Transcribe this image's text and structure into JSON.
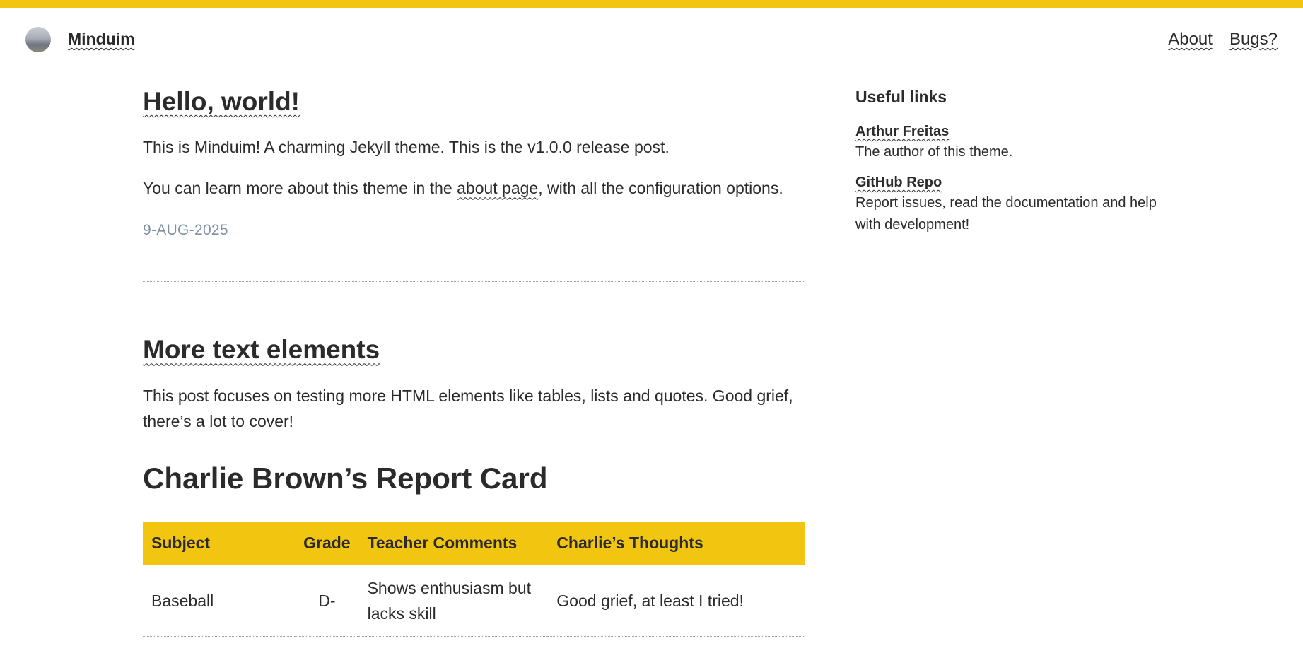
{
  "header": {
    "site_title": "Minduim",
    "nav": [
      {
        "label": "About"
      },
      {
        "label": "Bugs?"
      }
    ]
  },
  "posts": [
    {
      "title": "Hello, world!",
      "paragraphs": [
        "This is Minduim! A charming Jekyll theme. This is the v1.0.0 release post."
      ],
      "para2_before": "You can learn more about this theme in the ",
      "para2_link": "about page",
      "para2_after": ", with all the configuration options.",
      "date": "9-AUG-2025"
    },
    {
      "title": "More text elements",
      "paragraphs": [
        "This post focuses on testing more HTML elements like tables, lists and quotes. Good grief, there’s a lot to cover!"
      ],
      "report_heading": "Charlie Brown’s Report Card",
      "table": {
        "headers": [
          "Subject",
          "Grade",
          "Teacher Comments",
          "Charlie’s Thoughts"
        ],
        "rows": [
          [
            "Baseball",
            "D-",
            "Shows enthusiasm but lacks skill",
            "Good grief, at least I tried!"
          ]
        ]
      }
    }
  ],
  "sidebar": {
    "title": "Useful links",
    "links": [
      {
        "name": "Arthur Freitas",
        "desc": "The author of this theme."
      },
      {
        "name": "GitHub Repo",
        "desc": "Report issues, read the documentation and help with development!"
      }
    ]
  },
  "colors": {
    "accent": "#f2c511",
    "text": "#2b2b2b",
    "muted": "#8090a3"
  }
}
